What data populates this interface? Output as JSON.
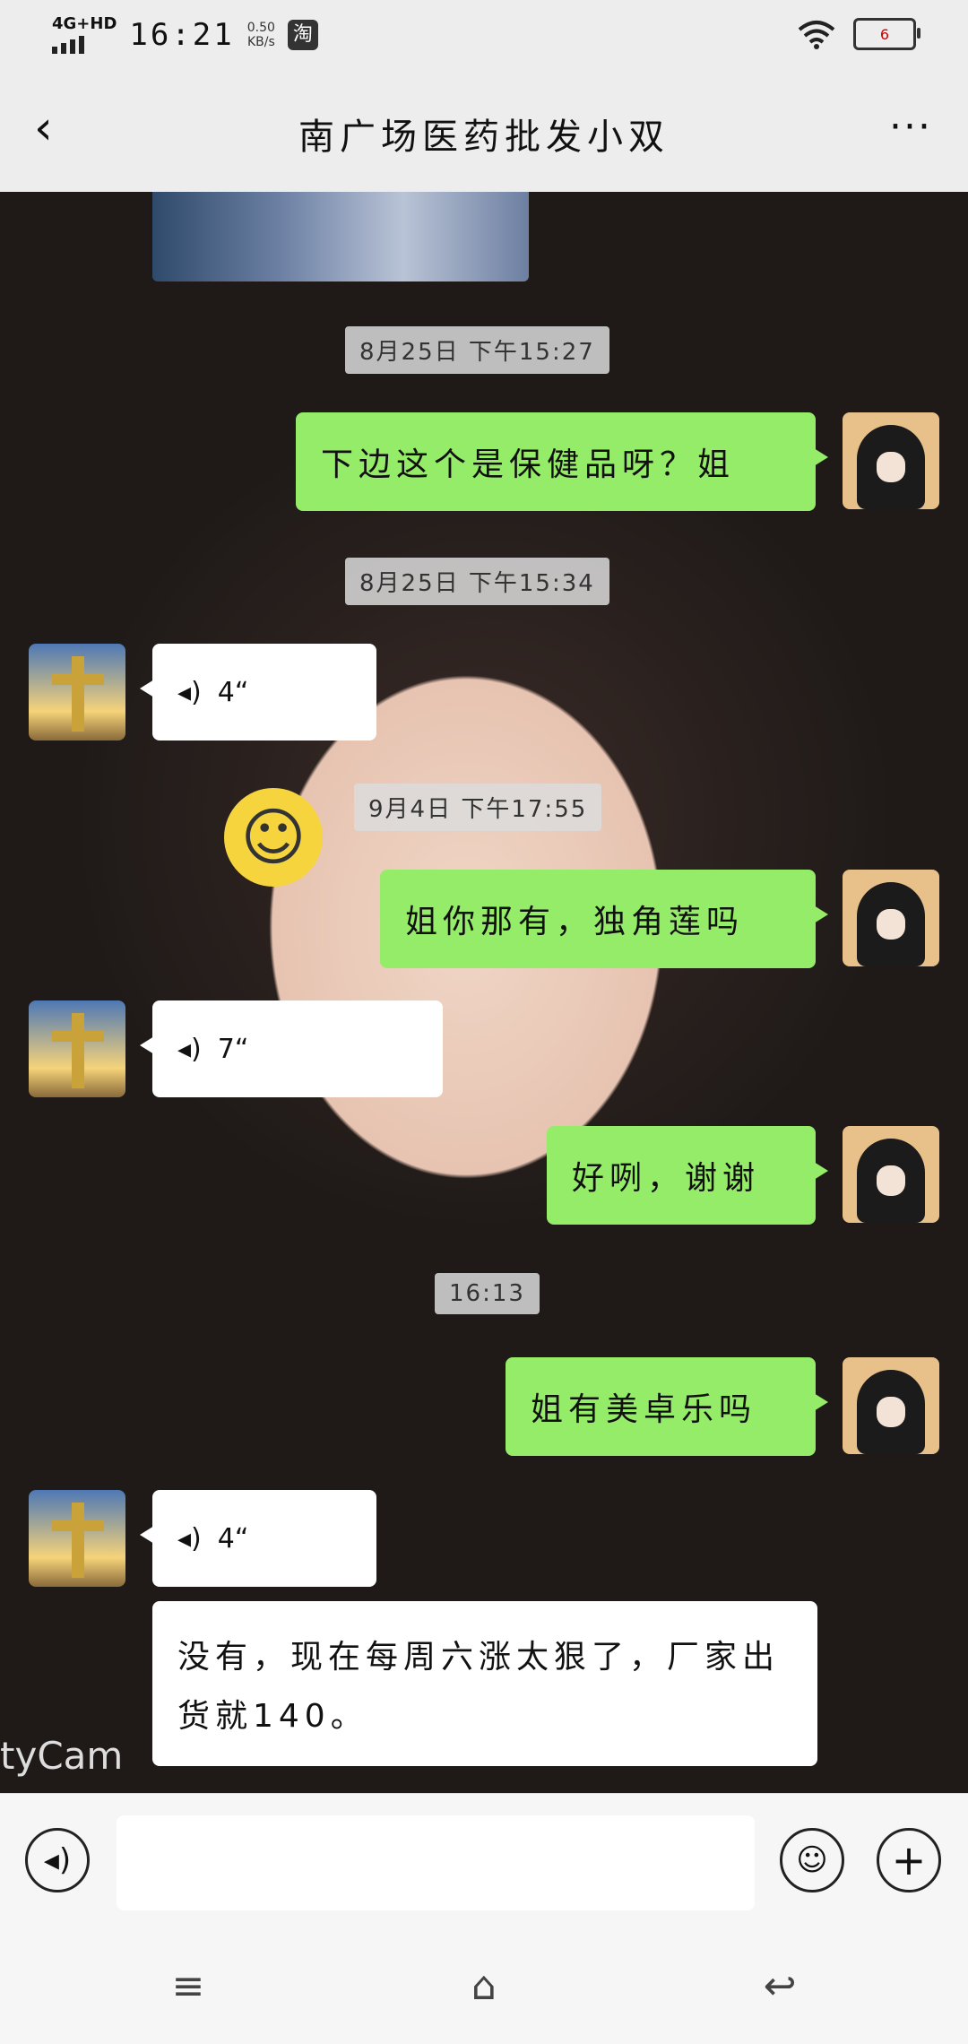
{
  "status_bar": {
    "network": "4G+HD",
    "time": "16:21",
    "speed_value": "0.50",
    "speed_unit": "KB/s",
    "app_icon_char": "淘",
    "battery_text": "6",
    "icons": [
      "signal-icon",
      "wifi-icon",
      "battery-icon"
    ]
  },
  "header": {
    "back_glyph": "‹",
    "title": "南广场医药批发小双",
    "more_glyph": "···"
  },
  "messages": [
    {
      "type": "time",
      "text": "8月25日 下午15:27"
    },
    {
      "type": "text",
      "from": "me",
      "text": "下边这个是保健品呀？姐"
    },
    {
      "type": "time",
      "text": "8月25日 下午15:34"
    },
    {
      "type": "voice",
      "from": "other",
      "duration": "4“"
    },
    {
      "type": "time",
      "text": "9月4日 下午17:55"
    },
    {
      "type": "text",
      "from": "me",
      "text": "姐你那有，独角莲吗"
    },
    {
      "type": "voice",
      "from": "other",
      "duration": "7“"
    },
    {
      "type": "text",
      "from": "me",
      "text": "好咧，谢谢"
    },
    {
      "type": "time",
      "text": "16:13"
    },
    {
      "type": "text",
      "from": "me",
      "text": "姐有美卓乐吗"
    },
    {
      "type": "voice",
      "from": "other",
      "duration": "4“"
    },
    {
      "type": "text",
      "from": "other",
      "text": "没有，现在每周六涨太狠了，厂家出货就140。"
    }
  ],
  "wallpaper_watermark": "tyCam",
  "input_bar": {
    "voice_glyph": "◂)",
    "input_value": "",
    "emoji_glyph": "☺",
    "plus_glyph": "+"
  },
  "nav_bar": {
    "menu_glyph": "≡",
    "home_glyph": "⌂",
    "back_glyph": "↩"
  },
  "colors": {
    "my_bubble": "#95ec69",
    "other_bubble": "#ffffff",
    "bar_bg": "#ededed"
  }
}
